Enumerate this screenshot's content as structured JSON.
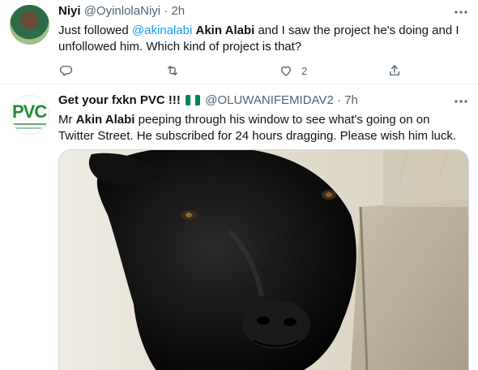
{
  "tweets": [
    {
      "name": "Niyi",
      "handle": "@OyinlolaNiyi",
      "separator": "·",
      "time": "2h",
      "more_icon": "more-horizontal-icon",
      "text_parts": {
        "t1": "Just followed ",
        "mention": "@akinalabi",
        "t2": " ",
        "bold": "Akin Alabi",
        "t3": " and I saw the project he's doing and I unfollowed him. Which kind of project is that?"
      },
      "actions": {
        "reply_icon": "reply-icon",
        "retweet_icon": "retweet-icon",
        "like_icon": "heart-icon",
        "like_count": "2",
        "share_icon": "share-icon"
      }
    },
    {
      "name": "Get your fxkn PVC !!!",
      "flag_icon": "nigeria-flag-icon",
      "handle": "@OLUWANIFEMIDAV2",
      "separator": "·",
      "time": "7h",
      "more_icon": "more-horizontal-icon",
      "avatar_logo": "PVC",
      "text_parts": {
        "t1": "Mr ",
        "bold": "Akin Alabi",
        "t2": " peeping through his window to see what's going on on Twitter Street. He subscribed for 24 hours dragging. Please wish him luck."
      },
      "media": "goat-photo"
    }
  ],
  "colors": {
    "link": "#1d9bf0",
    "secondary": "#536471",
    "text": "#0f1419",
    "nigeria_green": "#008751"
  }
}
